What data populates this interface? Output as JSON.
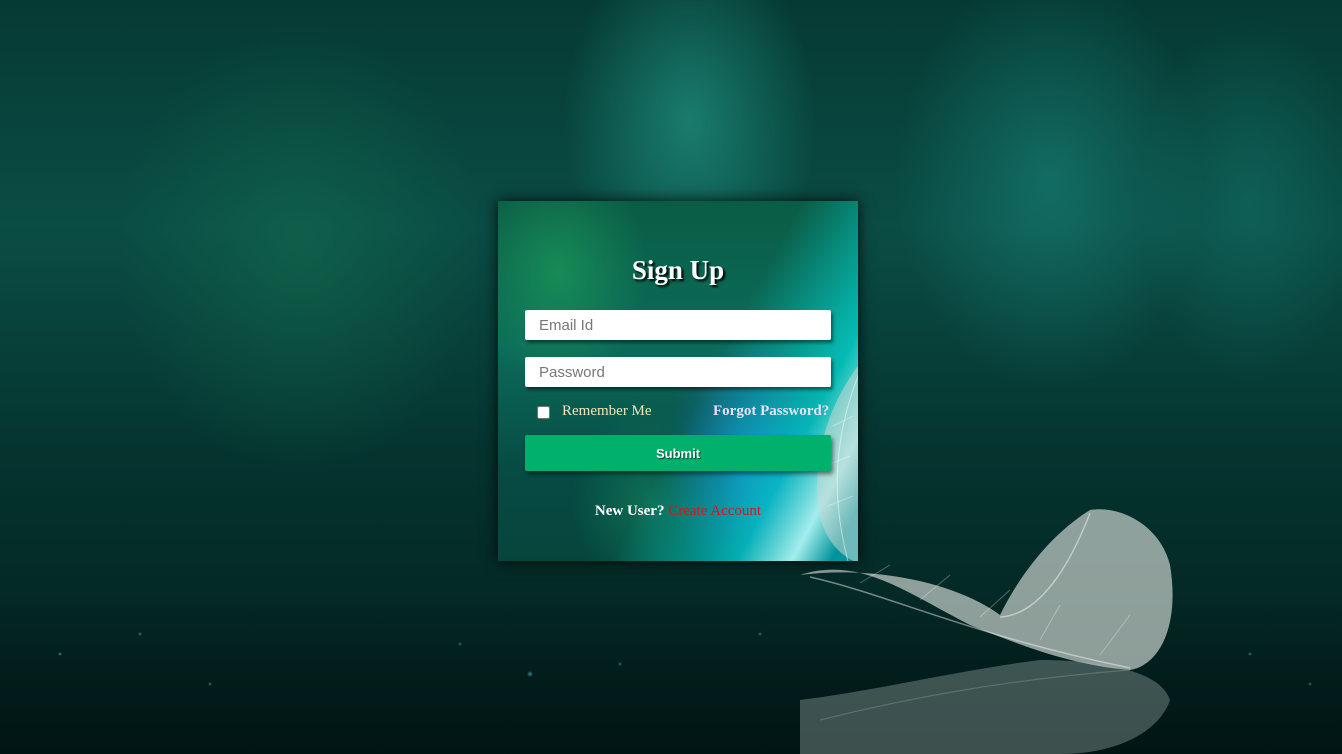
{
  "background": {
    "accent_color": "#0a4d45"
  },
  "form": {
    "title": "Sign Up",
    "email_placeholder": "Email Id",
    "email_value": "",
    "password_placeholder": "Password",
    "password_value": "",
    "remember_label": "Remember Me",
    "remember_checked": false,
    "forgot_label": "Forgot Password?",
    "submit_label": "Submit",
    "new_user_text": "New User?",
    "create_account_label": "Create Account",
    "colors": {
      "submit": "#00b06b",
      "create_account_link": "#e0101a",
      "remember_label": "#f2e6b8"
    }
  }
}
